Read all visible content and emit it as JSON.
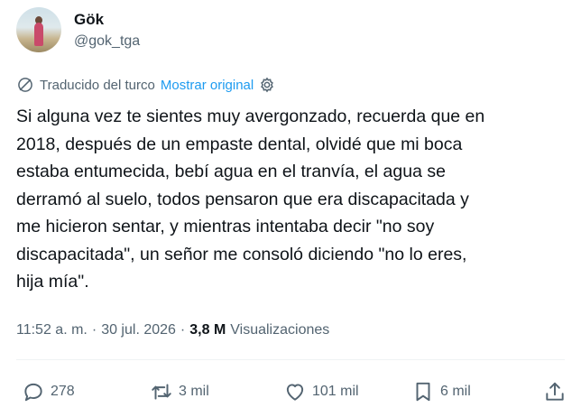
{
  "author": {
    "name": "Gök",
    "handle": "@gok_tga"
  },
  "translation": {
    "label": "Traducido del turco",
    "show_original": "Mostrar original"
  },
  "tweet": {
    "text": "Si alguna vez te sientes muy avergonzado, recuerda que en\n2018, después de un empaste dental, olvidé que mi boca\nestaba entumecida, bebí agua en el tranvía, el agua se\nderramó al suelo, todos pensaron que era discapacitada y\nme hicieron sentar, y mientras intentaba decir \"no soy\ndiscapacitada\", un señor me consoló diciendo \"no lo eres,\nhija mía\"."
  },
  "meta": {
    "time": "11:52 a. m.",
    "sep1": "·",
    "date": "30 jul. 2026",
    "sep2": "·",
    "views_count": "3,8 M",
    "views_label": "Visualizaciones"
  },
  "actions": {
    "replies": "278",
    "retweets": "3 mil",
    "likes": "101 mil",
    "bookmarks": "6 mil"
  },
  "icons": {
    "translate": "translate-icon",
    "settings": "gear-icon",
    "reply": "reply-icon",
    "retweet": "retweet-icon",
    "like": "heart-icon",
    "bookmark": "bookmark-icon",
    "share": "share-icon"
  },
  "colors": {
    "accent": "#1d9bf0",
    "text": "#0f1419",
    "secondary": "#536471"
  }
}
